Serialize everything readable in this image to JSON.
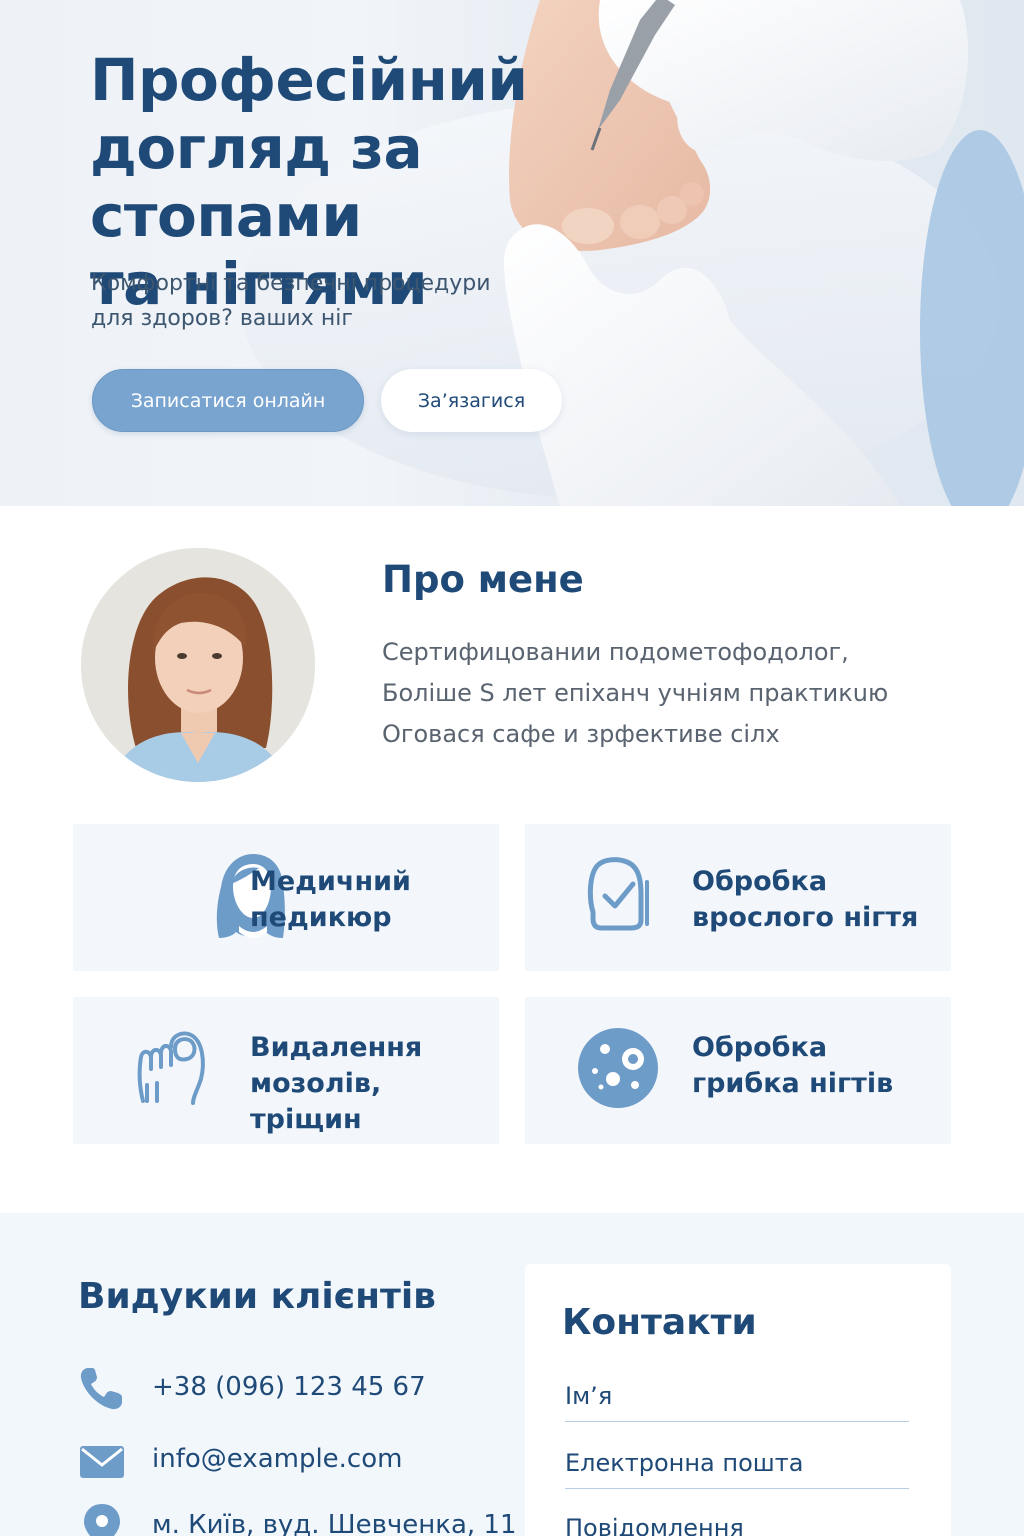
{
  "hero": {
    "title_line1": "Професійний",
    "title_line2": "догляд за стопами",
    "title_line3": "та нігтями",
    "subtitle_line1": "Комфортні та безпечні процедури",
    "subtitle_line2": "для здоров? ваших ніг",
    "primary_button": "Записатися онлайн",
    "secondary_button": "За’язагися"
  },
  "about": {
    "title": "Про мене",
    "line1": "Сертифицовании подометофодолог,",
    "line2": "Боліше S лет епіханч учніям практикuю",
    "line3": "Оговася сафе и зрфективе сілх"
  },
  "services": [
    {
      "line1": "Медичний",
      "line2": "педикюр",
      "icon": "woman-icon"
    },
    {
      "line1": "Обробка",
      "line2": "врослого нігтя",
      "icon": "nail-check-icon"
    },
    {
      "line1": "Видалення",
      "line2": "мозолів, тріщин",
      "icon": "foot-icon"
    },
    {
      "line1": "Обробка",
      "line2": "грибка нігтів",
      "icon": "fungus-icon"
    }
  ],
  "reviews": {
    "title": "Видукии клієнтів",
    "phone": "+38 (096) 123 45 67",
    "email": "info@example.com",
    "address": "м. Київ, вуд. Шевченка, 11"
  },
  "contact": {
    "title": "Контакти",
    "name_placeholder": "Ім’я",
    "email_placeholder": "Електронна пошта",
    "message_placeholder": "Повідомлення"
  },
  "colors": {
    "primary": "#1f4a78",
    "accent": "#78a4cf",
    "service_bg": "#f3f7fc",
    "section_bg": "#f2f7fc"
  }
}
